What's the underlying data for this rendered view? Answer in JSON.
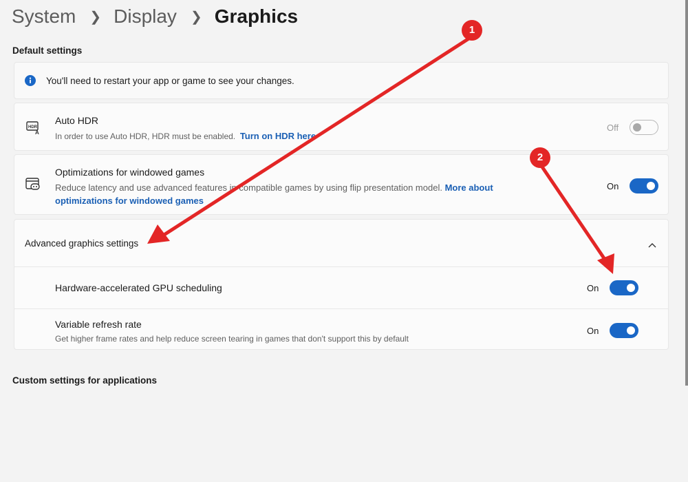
{
  "breadcrumb": [
    "System",
    "Display",
    "Graphics"
  ],
  "sections": {
    "default_settings": "Default settings",
    "custom_settings": "Custom settings for applications"
  },
  "info_banner": {
    "text": "You'll need to restart your app or game to see your changes."
  },
  "auto_hdr": {
    "title": "Auto HDR",
    "desc": "In order to use Auto HDR, HDR must be enabled.",
    "link": "Turn on HDR here",
    "state_label": "Off",
    "state": "off"
  },
  "windowed_games": {
    "title": "Optimizations for windowed games",
    "desc": "Reduce latency and use advanced features in compatible games by using flip presentation model.",
    "link1": "More about",
    "link2": "optimizations for windowed games",
    "state_label": "On",
    "state": "on"
  },
  "advanced": {
    "title": "Advanced graphics settings",
    "expanded": true
  },
  "gpu_scheduling": {
    "title": "Hardware-accelerated GPU scheduling",
    "state_label": "On",
    "state": "on"
  },
  "refresh_rate": {
    "title": "Variable refresh rate",
    "desc": "Get higher frame rates and help reduce screen tearing in games that don't support this by default",
    "state_label": "On",
    "state": "on"
  },
  "annotations": {
    "badge1": "1",
    "badge2": "2"
  },
  "colors": {
    "accent": "#1a67c6",
    "link": "#1a5fb4",
    "annotation_red": "#e32626"
  },
  "icons": [
    "info-icon",
    "hdr-icon",
    "windowed-game-icon",
    "chevron-up-icon",
    "chevron-right-icon"
  ]
}
